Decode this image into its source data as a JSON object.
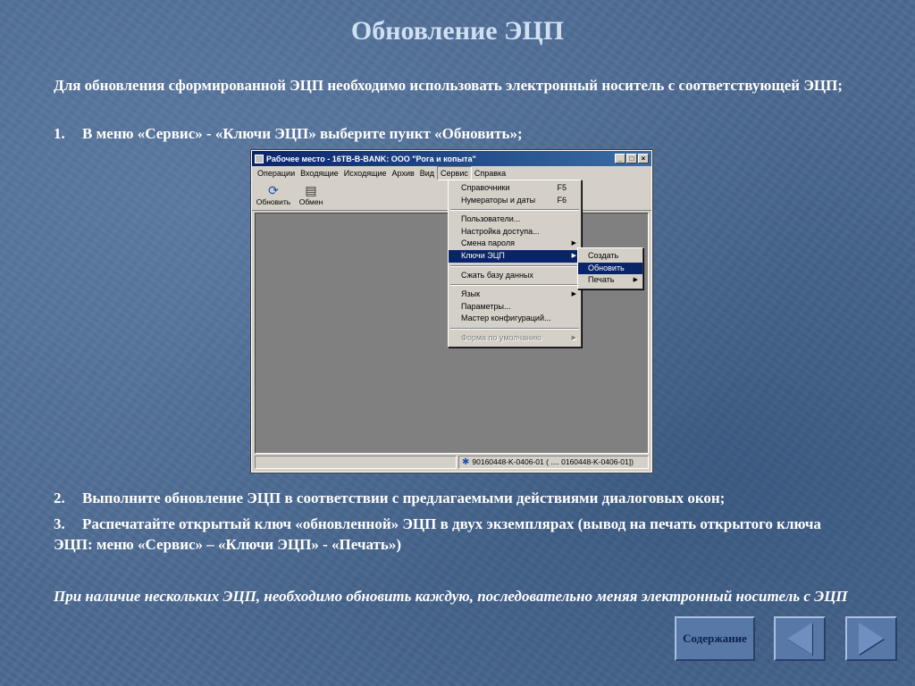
{
  "slide": {
    "title": "Обновление ЭЦП",
    "intro": "Для обновления сформированной ЭЦП необходимо использовать электронный носитель с соответствующей ЭЦП;",
    "steps": [
      {
        "num": "1.",
        "text": "В меню «Сервис» - «Ключи ЭЦП» выберите пункт «Обновить»;"
      },
      {
        "num": "2.",
        "text": "Выполните обновление ЭЦП в соответствии с предлагаемыми действиями диалоговых окон;"
      },
      {
        "num": "3.",
        "text": "Распечатайте открытый ключ «обновленной» ЭЦП в двух экземплярах (вывод на печать открытого ключа ЭЦП: меню «Сервис» – «Ключи ЭЦП» - «Печать»)"
      }
    ],
    "note": "При наличие нескольких ЭЦП, необходимо обновить каждую, последовательно меняя электронный носитель с ЭЦП"
  },
  "window": {
    "title": "Рабочее место - 16TB-B-BANK: ООО \"Рога и копыта\"",
    "buttons": {
      "minimize": "_",
      "maximize": "□",
      "close": "×"
    },
    "menubar": [
      "Операции",
      "Входящие",
      "Исходящие",
      "Архив",
      "Вид",
      "Сервис",
      "Справка"
    ],
    "toolbar": [
      {
        "label": "Обновить",
        "icon": "refresh-icon",
        "glyph": "⟳"
      },
      {
        "label": "Обмен",
        "icon": "exchange-icon",
        "glyph": "▤"
      }
    ],
    "status_left": "",
    "status_right": "90160448-K-0406-01 ( .... 0160448-K-0406-01])"
  },
  "service_menu": {
    "items": [
      {
        "label": "Справочники",
        "shortcut": "F5"
      },
      {
        "label": "Нумераторы и даты",
        "shortcut": "F6"
      },
      {
        "label": "Пользователи..."
      },
      {
        "label": "Настройка доступа..."
      },
      {
        "label": "Смена пароля"
      },
      {
        "label": "Ключи ЭЦП"
      },
      {
        "label": "Сжать базу данных"
      },
      {
        "label": "Язык"
      },
      {
        "label": "Параметры..."
      },
      {
        "label": "Мастер конфигураций..."
      },
      {
        "label": "Форма по умолчанию"
      }
    ]
  },
  "keys_submenu": {
    "items": [
      {
        "label": "Создать"
      },
      {
        "label": "Обновить"
      },
      {
        "label": "Печать"
      }
    ]
  },
  "navigation": {
    "toc_label": "Содержание",
    "prev_icon": "left-triangle-icon",
    "next_icon": "right-triangle-icon"
  },
  "colors": {
    "background": "#4d6a92",
    "title": "#cfe0f2",
    "menu_highlight": "#0a246a"
  }
}
